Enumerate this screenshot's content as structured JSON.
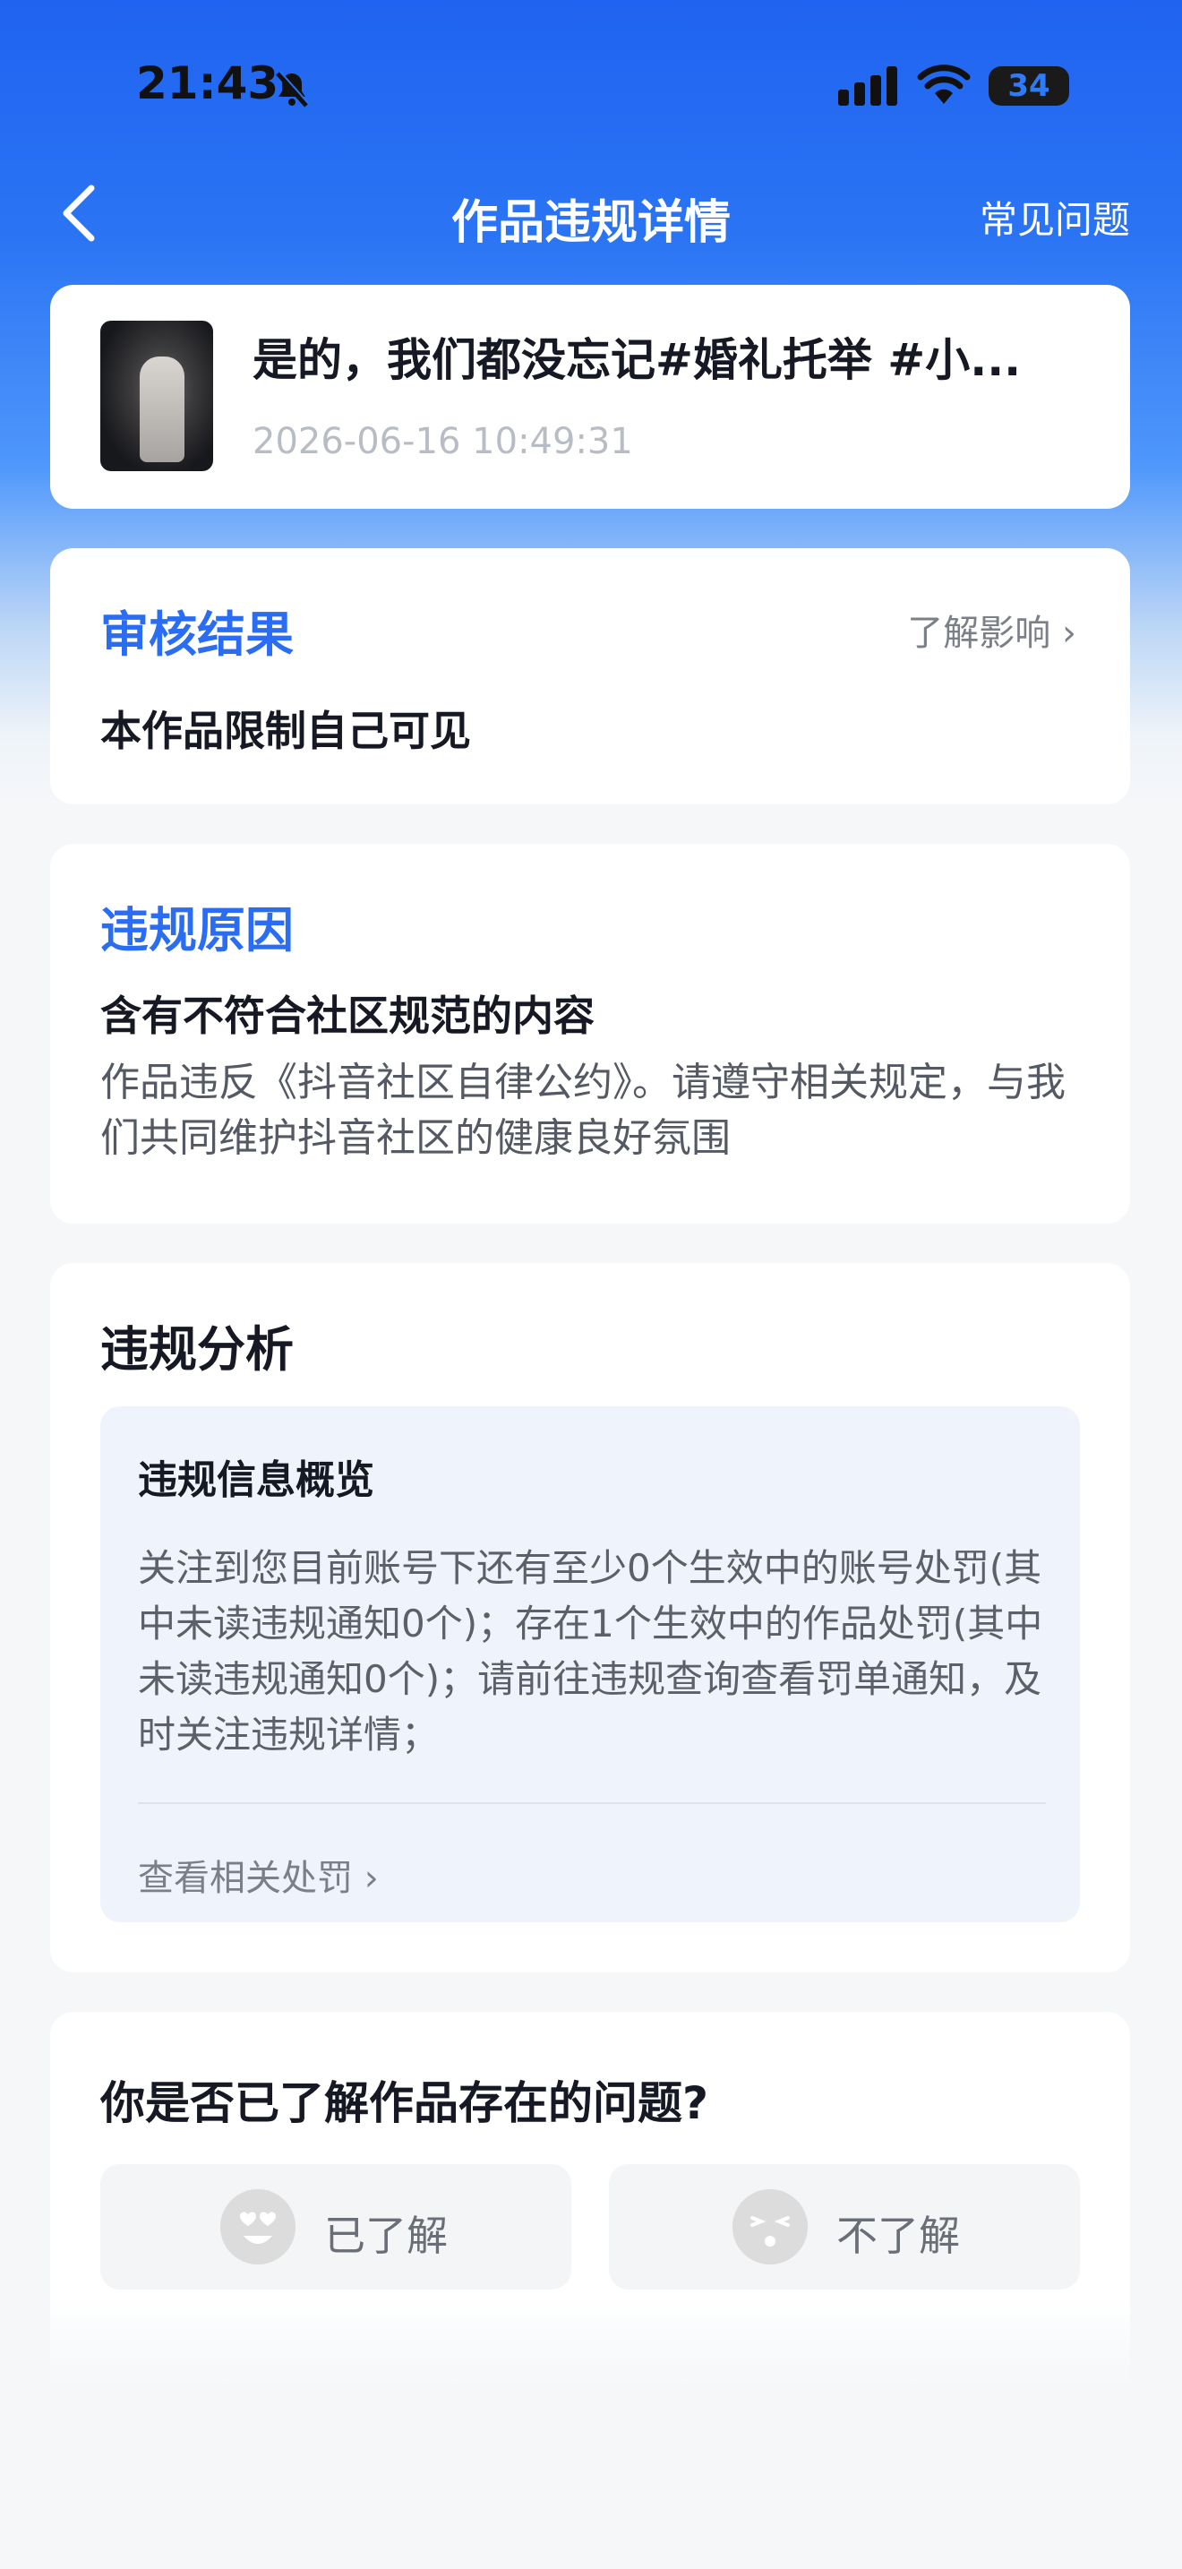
{
  "status_bar": {
    "time": "21:43",
    "battery": "34"
  },
  "nav": {
    "title": "作品违规详情",
    "faq": "常见问题"
  },
  "work": {
    "title": "是的，我们都没忘记#婚礼托举 #小...",
    "time": "2026-06-16 10:49:31"
  },
  "review": {
    "heading": "审核结果",
    "learn_more": "了解影响 ›",
    "result": "本作品限制自己可见"
  },
  "reason": {
    "heading": "违规原因",
    "summary": "含有不符合社区规范的内容",
    "description": "作品违反《抖音社区自律公约》。请遵守相关规定，与我们共同维护抖音社区的健康良好氛围"
  },
  "analysis": {
    "heading": "违规分析",
    "overview_title": "违规信息概览",
    "overview_text": "关注到您目前账号下还有至少0个生效中的账号处罚(其中未读违规通知0个)；存在1个生效中的作品处罚(其中未读违规通知0个)；请前往违规查询查看罚单通知，及时关注违规详情；",
    "view_penalty": "查看相关处罚 ›"
  },
  "feedback": {
    "question": "你是否已了解作品存在的问题?",
    "yes_label": "已了解",
    "no_label": "不了解"
  },
  "colors": {
    "accent_blue": "#2a6cf2",
    "header_gradient_top": "#1f63f0"
  }
}
